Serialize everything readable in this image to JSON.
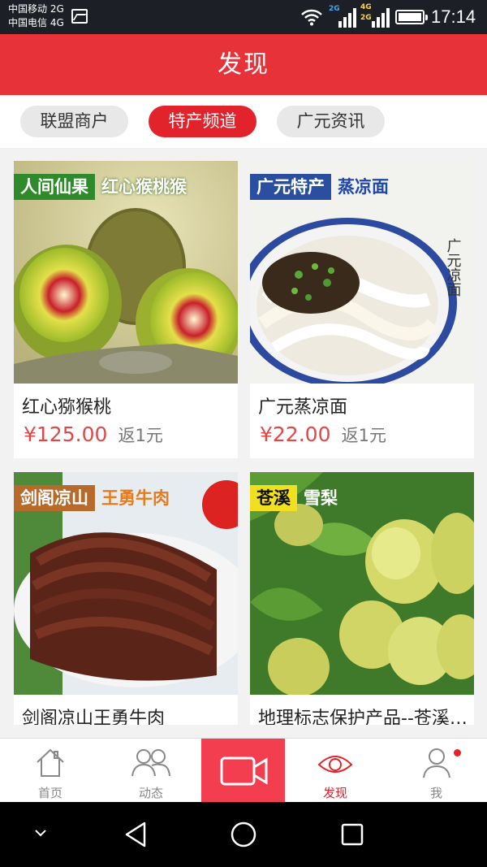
{
  "status_bar": {
    "carrier_1": "中国移动 2G",
    "carrier_2": "中国电信 4G",
    "net_2g": "2G",
    "net_4g": "4G",
    "net_4g_2": "2G",
    "time": "17:14",
    "icons": [
      "gallery-icon",
      "wifi-icon",
      "signal-icon",
      "battery-icon"
    ]
  },
  "header": {
    "title": "发现"
  },
  "tabs": [
    {
      "label": "联盟商户",
      "active": false
    },
    {
      "label": "特产频道",
      "active": true
    },
    {
      "label": "广元资讯",
      "active": false
    }
  ],
  "products": [
    {
      "badge_left": "人间仙果",
      "badge_right": "红心猴桃猴",
      "name": "红心猕猴桃",
      "price": "¥125.00",
      "rebate": "返1元",
      "image": "red-kiwi-image"
    },
    {
      "badge_left": "广元特产",
      "badge_right": "蒸凉面",
      "name": "广元蒸凉面",
      "price": "¥22.00",
      "rebate": "返1元",
      "image": "steamed-noodle-image",
      "calligraphy": "广元凉面"
    },
    {
      "badge_left": "剑阁凉山",
      "badge_right": "王勇牛肉",
      "name": "剑阁凉山王勇牛肉",
      "price": "",
      "rebate": "",
      "image": "beef-image"
    },
    {
      "badge_left": "苍溪",
      "badge_right": "雪梨",
      "name": "地理标志保护产品--苍溪雪梨",
      "price": "",
      "rebate": "",
      "image": "pear-image"
    }
  ],
  "bottom_nav": [
    {
      "label": "首页",
      "icon": "home-icon",
      "active": false
    },
    {
      "label": "动态",
      "icon": "users-icon",
      "active": false
    },
    {
      "label": "",
      "icon": "video-camera-icon",
      "active": false
    },
    {
      "label": "发现",
      "icon": "eye-icon",
      "active": true
    },
    {
      "label": "我",
      "icon": "user-icon",
      "active": false
    }
  ],
  "colors": {
    "brand_red": "#e8323a",
    "price_red": "#e04848",
    "camera_red": "#f23e4e"
  }
}
